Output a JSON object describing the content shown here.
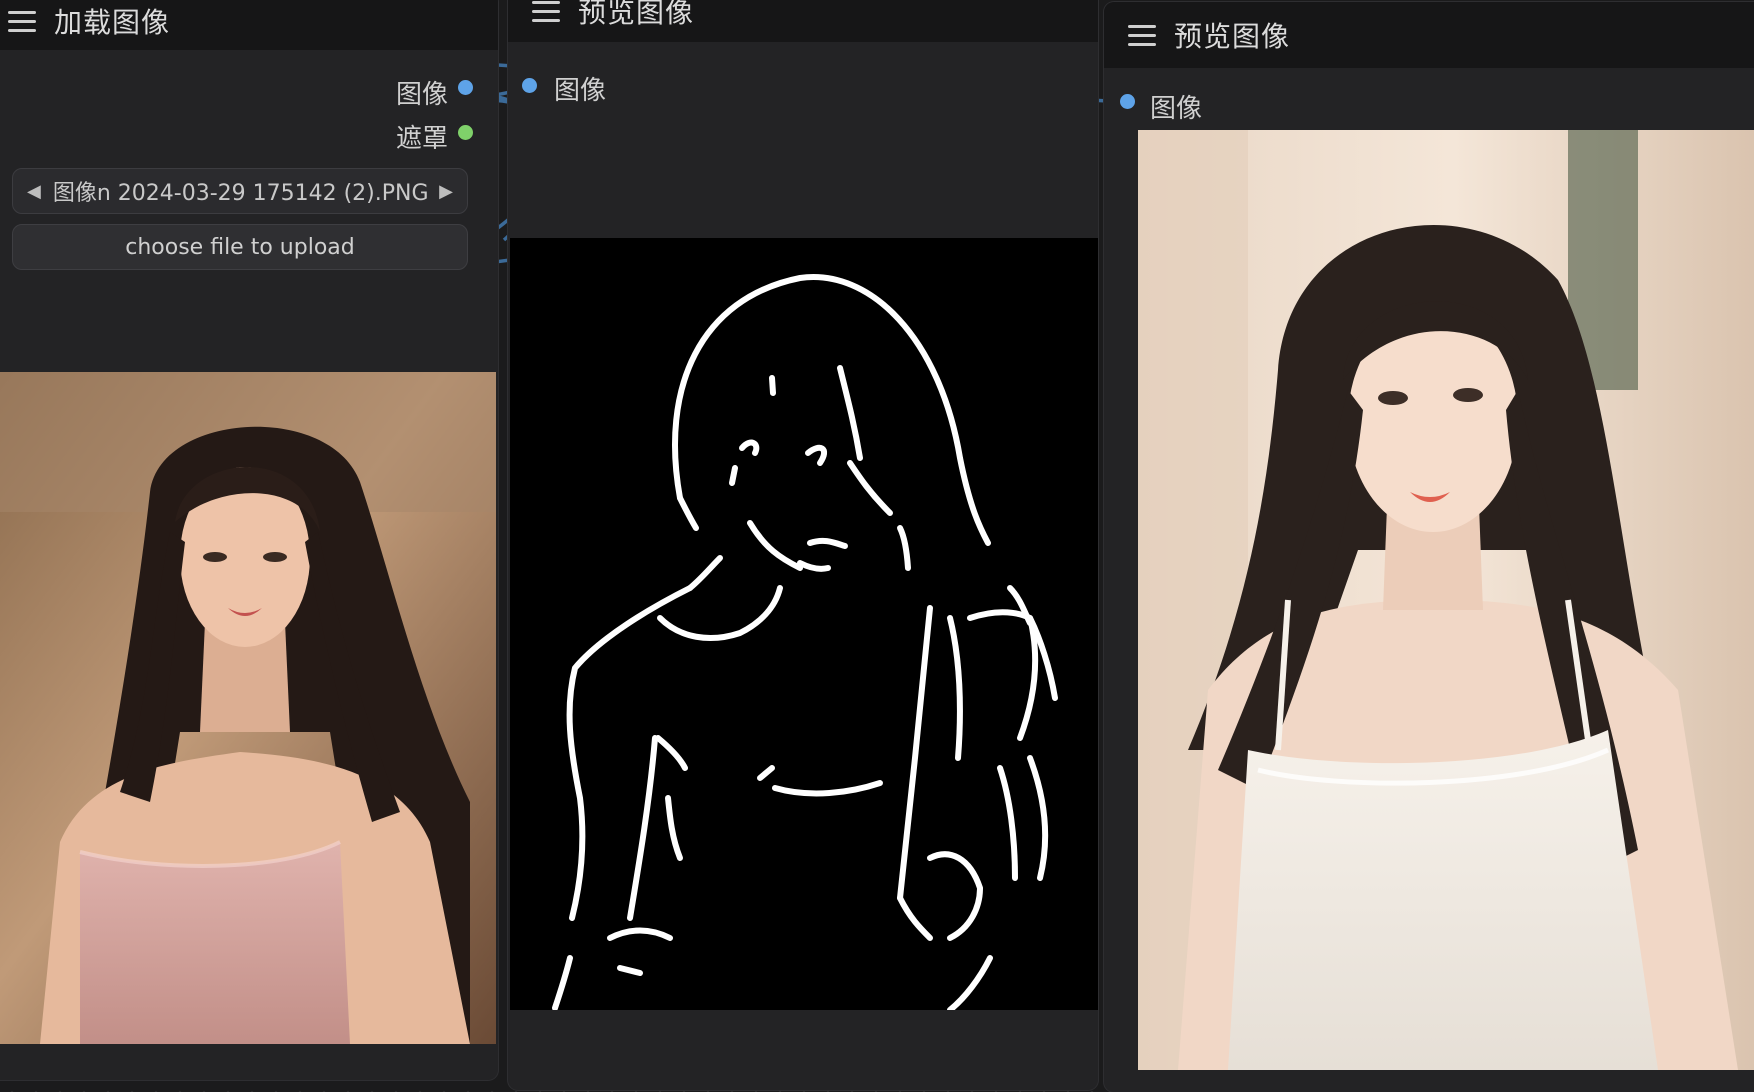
{
  "load_node": {
    "title": "加载图像",
    "outputs": {
      "image_label": "图像",
      "mask_label": "遮罩"
    },
    "file_combo": {
      "value": "图像n 2024-03-29 175142 (2).PNG",
      "left_arrow": "◀",
      "right_arrow": "▶"
    },
    "upload_label": "choose file to upload",
    "preview_alt": "woman in pink strapless dress"
  },
  "preview_node_1": {
    "title": "预览图像",
    "input_label": "图像",
    "preview_alt": "white line-art edge map on black"
  },
  "preview_node_2": {
    "title": "预览图像",
    "input_label": "图像",
    "preview_alt": "woman in white camisole"
  },
  "colors": {
    "image_slot": "#5ea3e8",
    "mask_slot": "#7fd16a",
    "link": "#3b6a98",
    "canvas": "#1b1b1c"
  }
}
